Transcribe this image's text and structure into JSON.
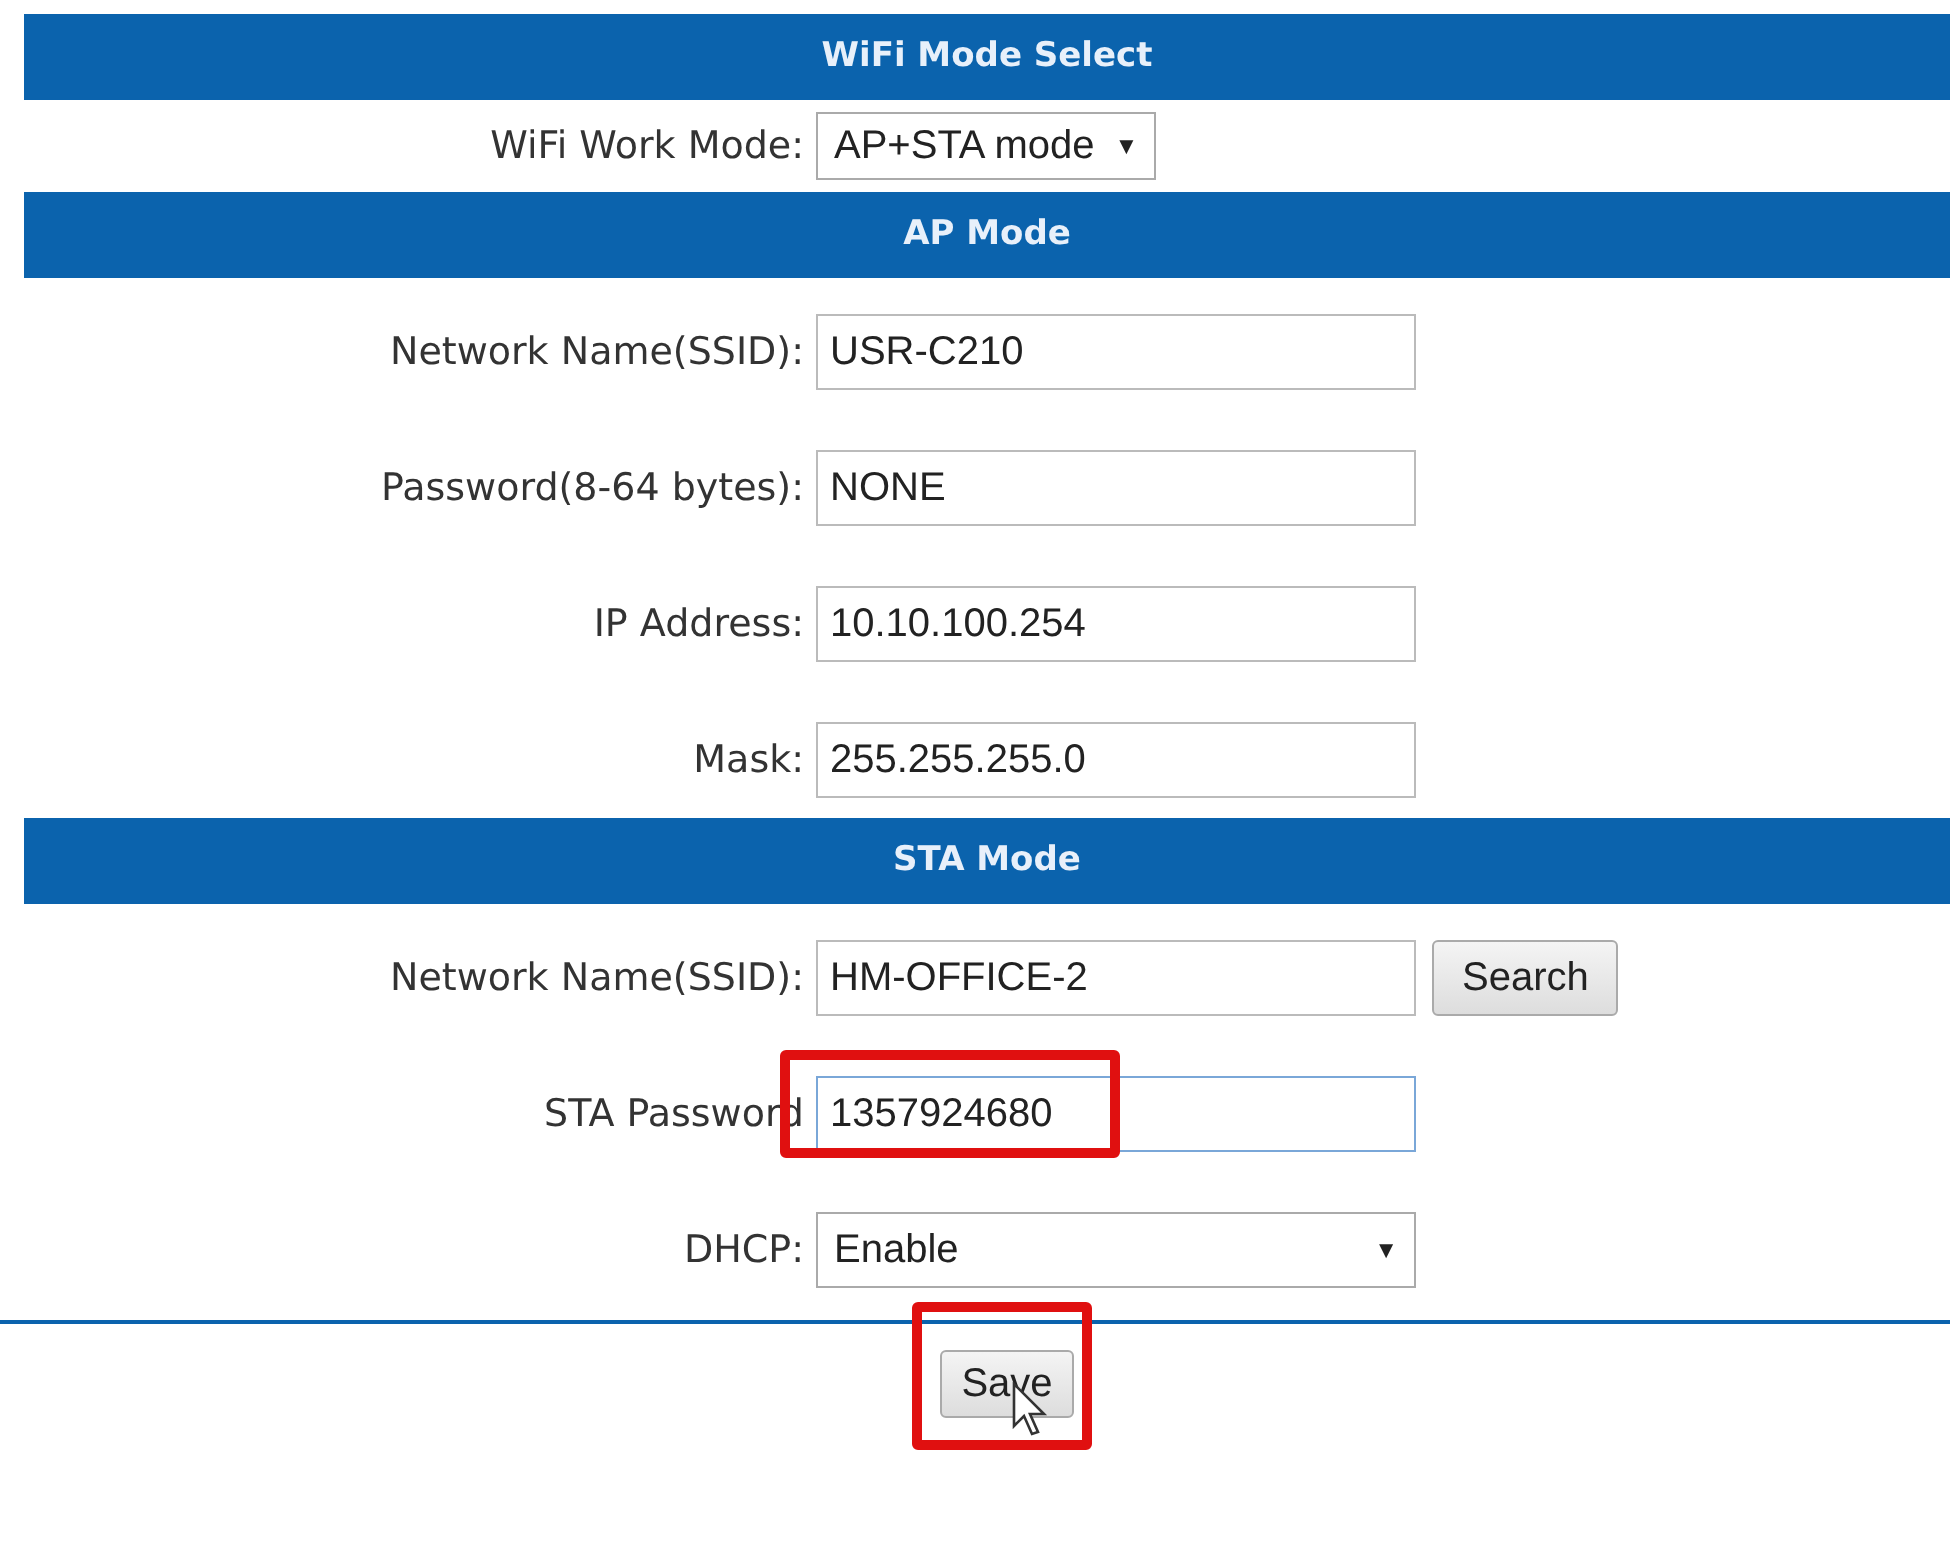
{
  "sections": [
    {
      "title": "WiFi Mode Select",
      "rows": [
        {
          "kind": "select",
          "label": "WiFi Work Mode:",
          "value": "AP+STA mode",
          "arrow": "▼",
          "highlighted": false
        }
      ]
    },
    {
      "title": "AP Mode",
      "rows": [
        {
          "kind": "input",
          "label": "Network Name(SSID):",
          "value": "USR-C210",
          "highlighted": false
        },
        {
          "kind": "input",
          "label": "Password(8-64 bytes):",
          "value": "NONE",
          "highlighted": false
        },
        {
          "kind": "input",
          "label": "IP Address:",
          "value": "10.10.100.254",
          "highlighted": false
        },
        {
          "kind": "input",
          "label": "Mask:",
          "value": "255.255.255.0",
          "highlighted": false
        }
      ]
    },
    {
      "title": "STA Mode",
      "rows": [
        {
          "kind": "input",
          "label": "Network Name(SSID):",
          "value": "HM-OFFICE-2",
          "button": "Search",
          "highlighted": false
        },
        {
          "kind": "input",
          "label": "STA Password",
          "value": "1357924680",
          "highlighted": true,
          "focused": true
        },
        {
          "kind": "wideselect",
          "label": "DHCP:",
          "value": "Enable",
          "arrow": "▼",
          "highlighted": false
        }
      ]
    }
  ],
  "save": {
    "label": "Save",
    "highlighted": true
  }
}
